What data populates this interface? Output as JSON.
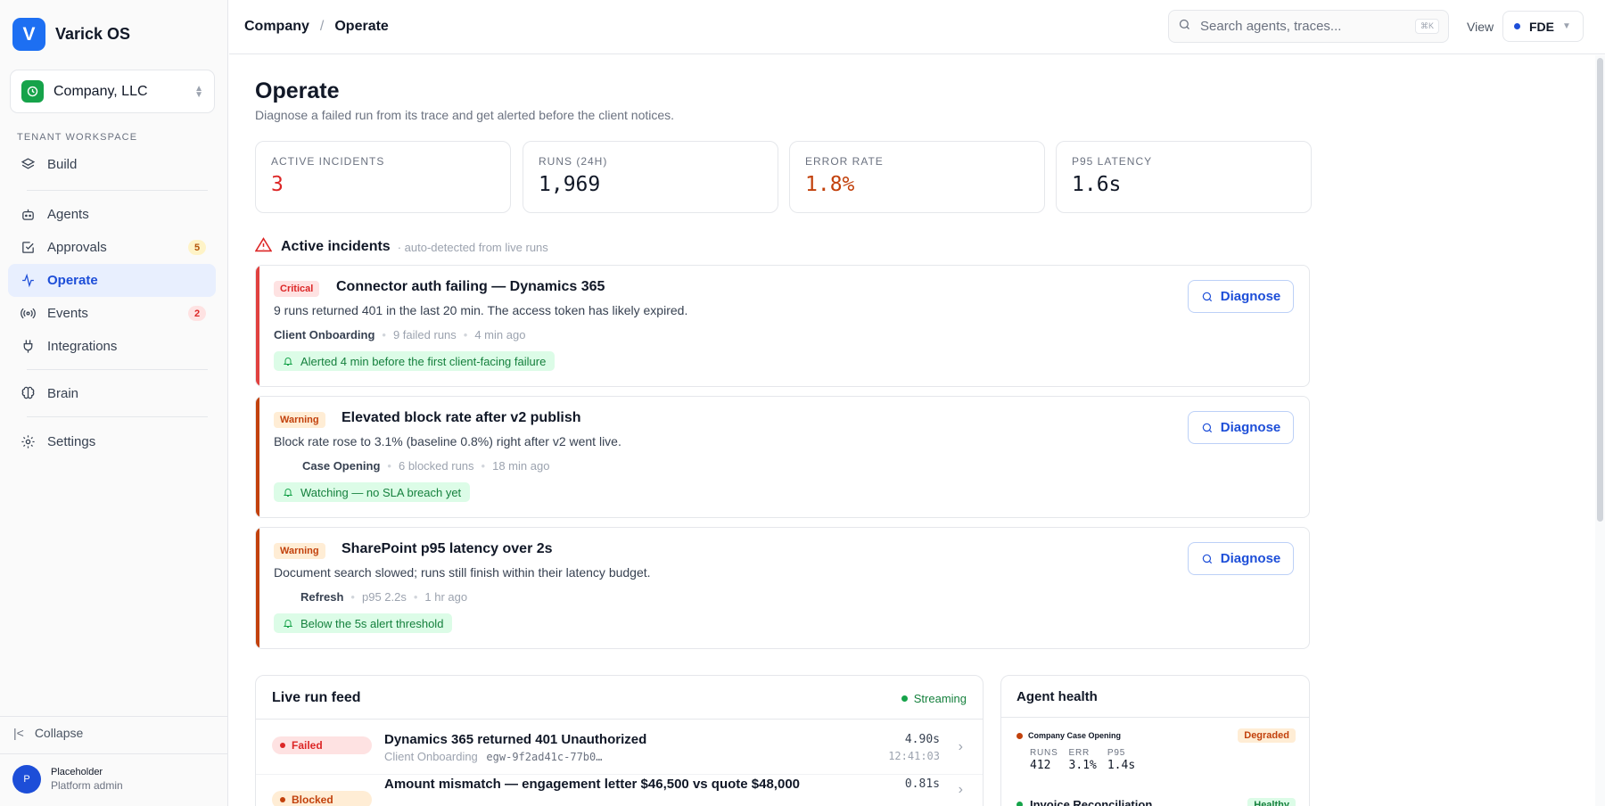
{
  "app": {
    "logo_letter": "V",
    "name": "Varick OS"
  },
  "tenant": {
    "name": "Company, LLC"
  },
  "sidebar": {
    "section_label": "TENANT WORKSPACE",
    "items": [
      {
        "label": "Build",
        "icon": "layers-icon"
      },
      {
        "label": "Agents",
        "icon": "bot-icon"
      },
      {
        "label": "Approvals",
        "icon": "checkbox-icon",
        "badge": "5"
      },
      {
        "label": "Operate",
        "icon": "activity-icon",
        "active": true
      },
      {
        "label": "Events",
        "icon": "broadcast-icon",
        "badge": "2"
      },
      {
        "label": "Integrations",
        "icon": "plug-icon"
      },
      {
        "label": "Brain",
        "icon": "brain-icon"
      },
      {
        "label": "Settings",
        "icon": "gear-icon"
      }
    ],
    "collapse_label": "Collapse",
    "user": {
      "initial": "P",
      "name": "Placeholder",
      "role": "Platform admin"
    }
  },
  "topbar": {
    "breadcrumb": [
      "Company",
      "Operate"
    ],
    "search_placeholder": "Search agents, traces...",
    "search_shortcut": "⌘K",
    "view_label": "View",
    "view_value": "FDE"
  },
  "page": {
    "title": "Operate",
    "subtitle": "Diagnose a failed run from its trace and get alerted before the client notices."
  },
  "stats": [
    {
      "label": "ACTIVE INCIDENTS",
      "value": "3",
      "color": "#dc2626"
    },
    {
      "label": "RUNS (24H)",
      "value": "1,969",
      "color": "#111827"
    },
    {
      "label": "ERROR RATE",
      "value": "1.8%",
      "color": "#c2410c"
    },
    {
      "label": "P95 LATENCY",
      "value": "1.6s",
      "color": "#111827"
    }
  ],
  "incidents": {
    "title": "Active incidents",
    "meta": "· auto-detected from live runs",
    "action_label": "Diagnose",
    "items": [
      {
        "severity": "Critical",
        "title": "Connector auth failing — Dynamics 365",
        "description": "9 runs returned 401 in the last 20 min. The access token has likely expired.",
        "owner": "Client Onboarding",
        "stat": "9 failed runs",
        "time": "4 min ago",
        "alert": "Alerted 4 min before the first client-facing failure",
        "accent": "#e0413f"
      },
      {
        "severity": "Warning",
        "title": "Elevated block rate after v2 publish",
        "description": "Block rate rose to 3.1% (baseline 0.8%) right after v2 went live.",
        "owner": "Case Opening",
        "stat": "6 blocked runs",
        "time": "18 min ago",
        "alert": "Watching — no SLA breach yet",
        "accent": "#c2410c"
      },
      {
        "severity": "Warning",
        "title": "SharePoint p95 latency over 2s",
        "description": "Document search slowed; runs still finish within their latency budget.",
        "owner": "Refresh",
        "stat": "p95 2.2s",
        "time": "1 hr ago",
        "alert": "Below the 5s alert threshold",
        "accent": "#c2410c"
      }
    ]
  },
  "feed": {
    "title": "Live run feed",
    "status": "Streaming",
    "rows": [
      {
        "status": "Failed",
        "title": "Dynamics 365 returned 401 Unauthorized",
        "agent": "Client Onboarding",
        "trace": "egw-9f2ad41c-77b0…",
        "duration": "4.90s",
        "time": "12:41:03"
      },
      {
        "status": "Blocked",
        "title": "Amount mismatch — engagement letter $46,500 vs quote $48,000",
        "duration": "0.81s"
      }
    ]
  },
  "health": {
    "title": "Agent health",
    "agents": [
      {
        "name": "Company Case Opening",
        "status": "Degraded",
        "metrics": [
          {
            "label": "RUNS",
            "value": "412"
          },
          {
            "label": "ERR",
            "value": "3.1%"
          },
          {
            "label": "P95",
            "value": "1.4s"
          }
        ]
      },
      {
        "name": "Invoice Reconciliation",
        "status": "Healthy"
      }
    ]
  }
}
